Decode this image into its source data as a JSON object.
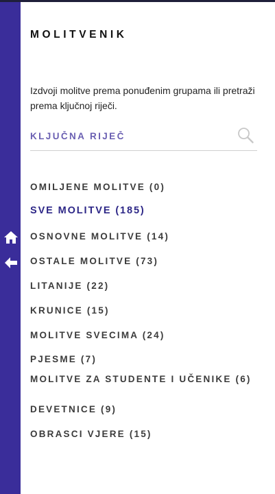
{
  "app": {
    "title": "MOLITVENIK",
    "intro": "Izdvoji molitve prema ponuđenim grupama ili pretraži prema ključnoj riječi."
  },
  "search": {
    "placeholder": "KLJUČNA RIJEČ",
    "value": ""
  },
  "rail": {
    "home_icon": "home-icon",
    "back_icon": "arrow-left-icon",
    "color": "#3a2d9a"
  },
  "categories": [
    {
      "label": "OMILJENE MOLITVE (0)",
      "active": false
    },
    {
      "label": "SVE MOLITVE (185)",
      "active": true
    },
    {
      "label": "OSNOVNE MOLITVE (14)",
      "active": false
    },
    {
      "label": "OSTALE MOLITVE (73)",
      "active": false
    },
    {
      "label": "LITANIJE (22)",
      "active": false
    },
    {
      "label": "KRUNICE (15)",
      "active": false
    },
    {
      "label": "MOLITVE SVECIMA (24)",
      "active": false
    },
    {
      "label": "PJESME (7)",
      "active": false
    },
    {
      "label": "MOLITVE ZA STUDENTE I UČENIKE (6)",
      "active": false
    },
    {
      "label": "DEVETNICE (9)",
      "active": false
    },
    {
      "label": "OBRASCI VJERE (15)",
      "active": false
    }
  ],
  "colors": {
    "accent": "#2d2787",
    "search_text": "#6a5fb2"
  }
}
